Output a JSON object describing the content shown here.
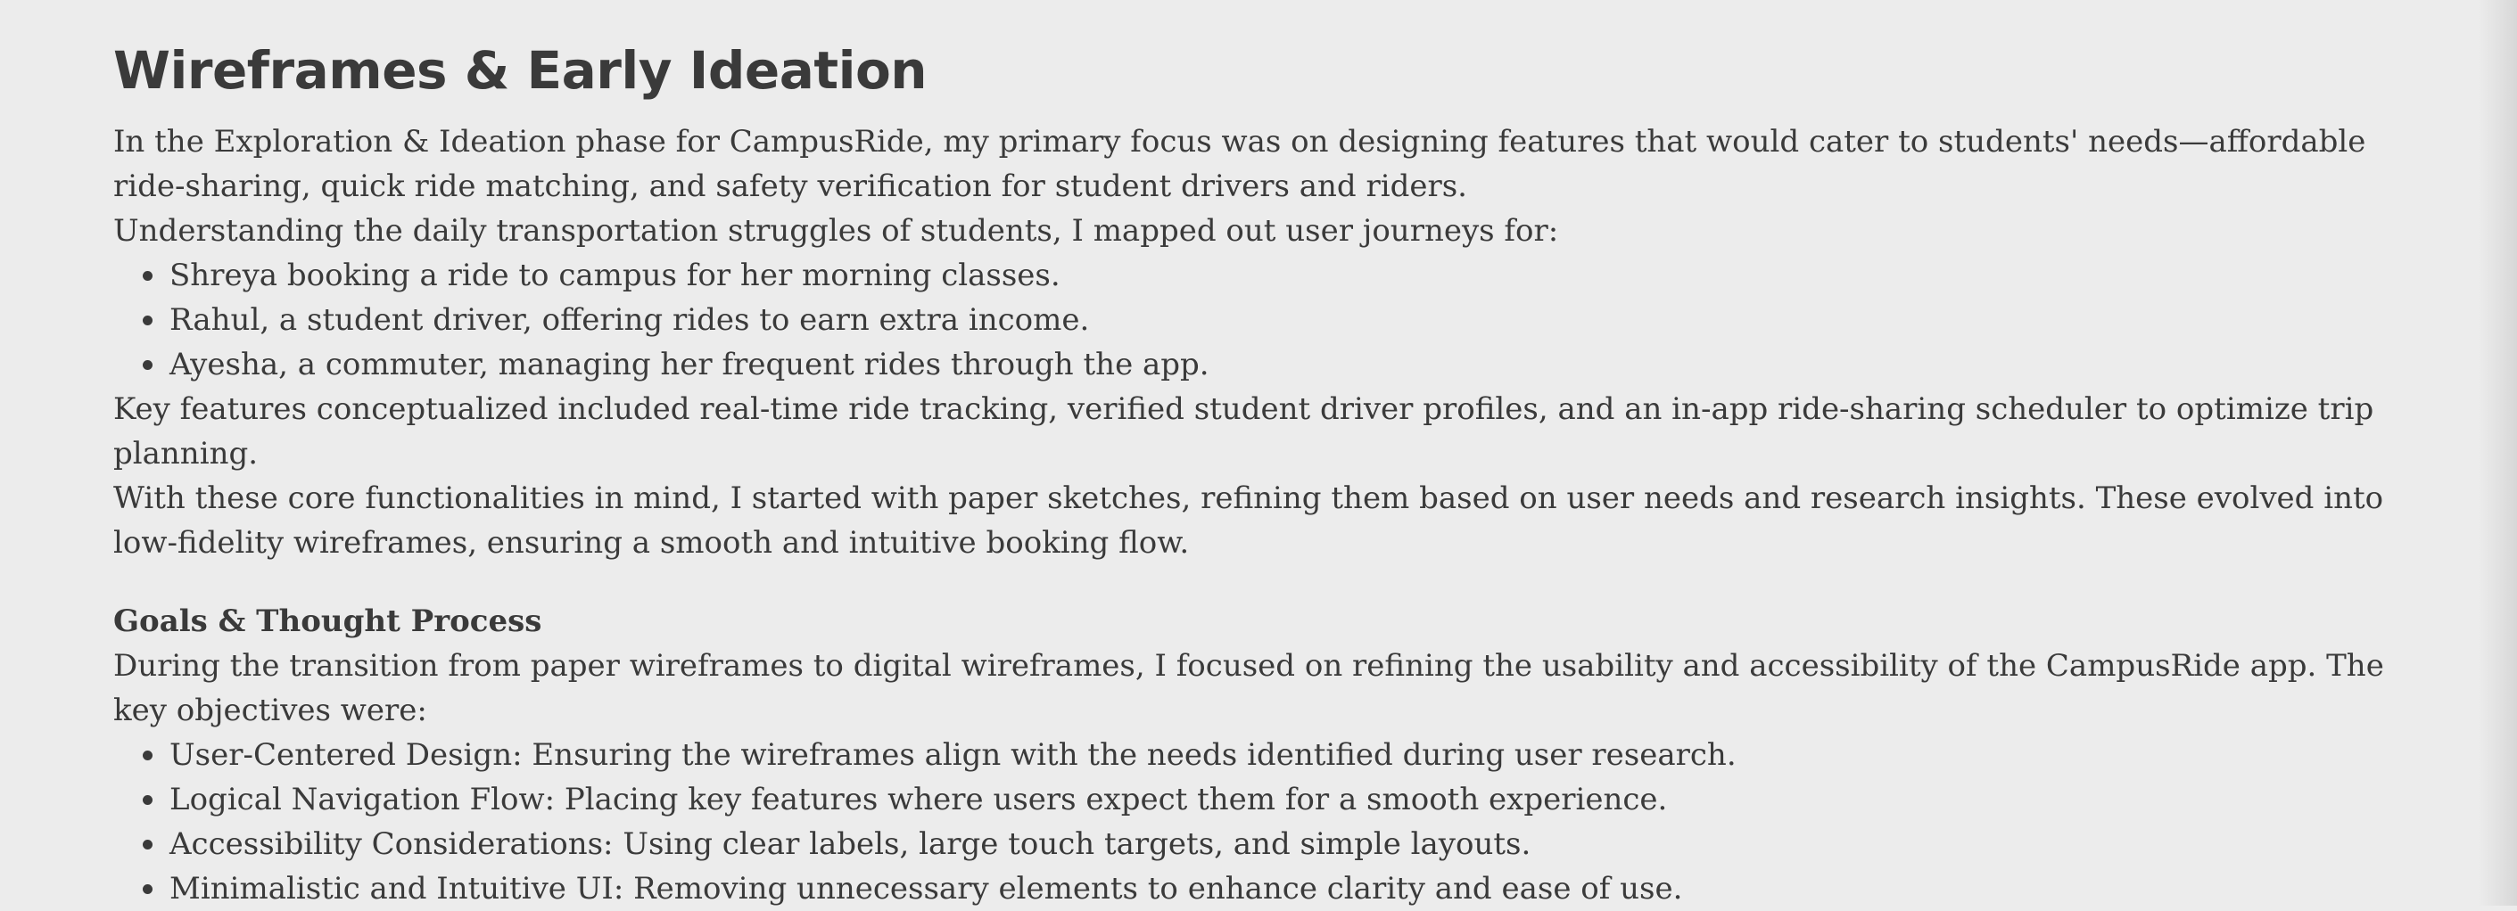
{
  "section1": {
    "title": "Wireframes & Early Ideation",
    "intro": "In the Exploration & Ideation phase for CampusRide, my primary focus was on designing features that would cater to students' needs—affordable ride-sharing, quick ride matching, and safety verification for student drivers and riders.",
    "journeys_intro": "Understanding the daily transportation struggles of students, I mapped out user journeys for:",
    "journeys": [
      "Shreya booking a ride to campus for her morning classes.",
      "Rahul, a student driver, offering rides to earn extra income.",
      "Ayesha, a commuter, managing her frequent rides through the app."
    ],
    "key_features": "Key features conceptualized included real-time ride tracking, verified student driver profiles, and an in-app ride-sharing scheduler to optimize trip planning.",
    "sketches": "With these core functionalities in mind, I started with paper sketches, refining them based on user needs and research insights. These evolved into low-fidelity wireframes, ensuring a smooth and intuitive booking flow."
  },
  "section2": {
    "title": "Goals & Thought Process",
    "intro": "During the transition from paper wireframes to digital wireframes, I focused on refining the usability and accessibility of the CampusRide app. The key objectives were:",
    "objectives": [
      "User-Centered Design: Ensuring the wireframes align with the needs identified during user research.",
      "Logical Navigation Flow: Placing key features where users expect them for a smooth experience.",
      "Accessibility Considerations: Using clear labels, large touch targets, and simple layouts.",
      "Minimalistic and Intuitive UI: Removing unnecessary elements to enhance clarity and ease of use."
    ]
  }
}
